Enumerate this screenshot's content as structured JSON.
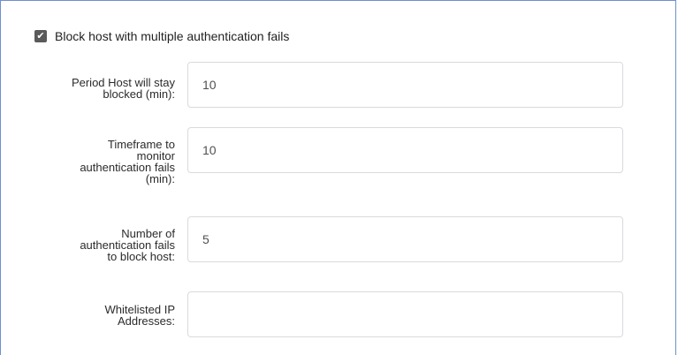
{
  "block_host": {
    "checked": true,
    "label": "Block host with multiple authentication fails"
  },
  "fields": {
    "period": {
      "label_lines": [
        "Period Host will stay",
        "blocked (min):"
      ],
      "value": "10"
    },
    "timeframe": {
      "label_lines": [
        "Timeframe to",
        "monitor",
        "authentication fails",
        "(min):"
      ],
      "value": "10"
    },
    "number": {
      "label_lines": [
        "Number of",
        "authentication fails",
        "to block host:"
      ],
      "value": "5"
    },
    "whitelist": {
      "label_lines": [
        "Whitelisted IP",
        "Addresses:"
      ],
      "value": ""
    }
  }
}
